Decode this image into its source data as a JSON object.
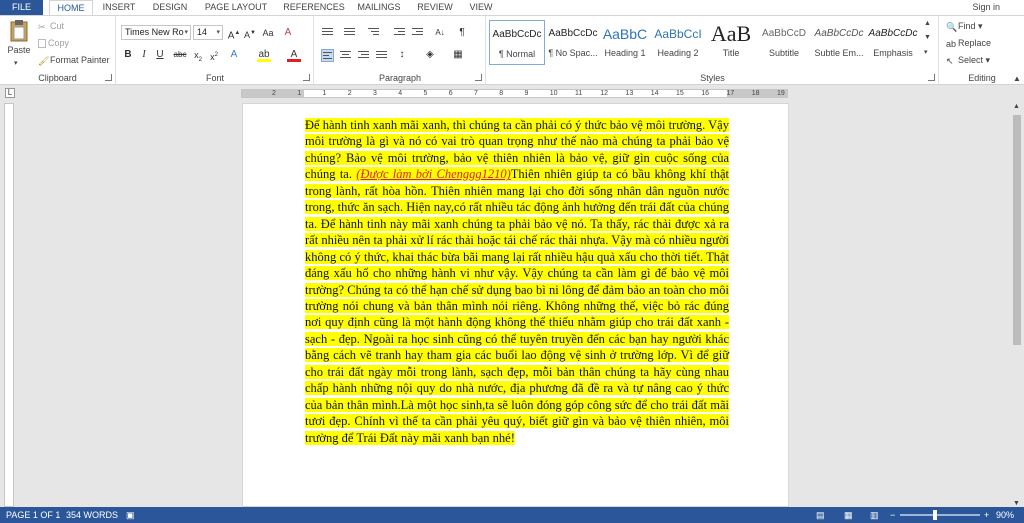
{
  "tabs": {
    "file": "FILE",
    "home": "HOME",
    "insert": "INSERT",
    "design": "DESIGN",
    "page_layout": "PAGE LAYOUT",
    "references": "REFERENCES",
    "mailings": "MAILINGS",
    "review": "REVIEW",
    "view": "VIEW"
  },
  "signin": "Sign in",
  "clipboard": {
    "label": "Clipboard",
    "paste": "Paste",
    "cut": "Cut",
    "copy": "Copy",
    "format_painter": "Format Painter"
  },
  "font": {
    "label": "Font",
    "name": "Times New Ro",
    "size": "14"
  },
  "paragraph": {
    "label": "Paragraph"
  },
  "styles": {
    "label": "Styles",
    "items": [
      {
        "preview": "AaBbCcDc",
        "name": "¶ Normal"
      },
      {
        "preview": "AaBbCcDc",
        "name": "¶ No Spac..."
      },
      {
        "preview": "AaBbC",
        "name": "Heading 1"
      },
      {
        "preview": "AaBbCcI",
        "name": "Heading 2"
      },
      {
        "preview": "AaB",
        "name": "Title"
      },
      {
        "preview": "AaBbCcD",
        "name": "Subtitle"
      },
      {
        "preview": "AaBbCcDc",
        "name": "Subtle Em..."
      },
      {
        "preview": "AaBbCcDc",
        "name": "Emphasis"
      }
    ]
  },
  "editing": {
    "label": "Editing",
    "find": "Find",
    "replace": "Replace",
    "select": "Select"
  },
  "ruler_ticks": [
    "2",
    "1",
    "1",
    "2",
    "3",
    "4",
    "5",
    "6",
    "7",
    "8",
    "9",
    "10",
    "11",
    "12",
    "13",
    "14",
    "15",
    "16",
    "17",
    "18",
    "19"
  ],
  "document": {
    "text1": "Để hành tinh xanh mãi xanh, thì chúng ta cần phải có ý thức bảo vệ môi trường. Vậy môi trường là gì và nó có vai trò quan trọng như thế nào mà chúng ta phải bảo vệ chúng? Bảo vệ môi trường, bảo vệ thiên nhiên là bảo vệ, giữ gìn cuộc sống của chúng ta. ",
    "credit": "(Được làm bởi Chenggg1210)",
    "text2": "Thiên nhiên giúp ta có bầu không khí thật trong lành, rất hòa hồn. Thiên nhiên mang lại cho đời sống nhân dân nguồn nước trong, thức ăn sạch. Hiện nay,có rất nhiều tác động ảnh hưởng đến trái đất của chúng ta. Để hành tinh này mãi xanh chúng ta phải bảo vệ nó. Ta thấy, rác thải được xả ra rất nhiều nên ta phải xử lí rác thải hoặc tái chế rác thải nhựa. Vậy mà có nhiều người không có ý thức, khai thác bừa bãi mang lại rất nhiều hậu quả xấu cho thời tiết. Thật đáng xấu hổ cho những hành vi như vậy. Vậy chúng ta cần làm gì để bảo vệ môi trường? Chúng ta có thể hạn chế sử dụng bao bì ni lông để đảm bảo an toàn cho môi trường nói chung và bản thân mình nói riêng. Không những thế, việc bỏ rác đúng nơi quy định cũng là một hành động không thể thiếu nhằm giúp cho trái đất xanh - sạch - đẹp. Ngoài ra học sinh cũng có thể tuyên truyền đến các bạn hay người khác bằng cách vẽ tranh hay tham gia các buổi lao động vệ sinh ở trường lớp. Vì để giữ cho trái đất ngày mỗi trong lành, sạch đẹp, mỗi bản thân chúng ta hãy cùng nhau chấp hành những nội quy do nhà nước, địa phương đã đề ra và tự nâng cao ý thức của bản thân mình.Là một học sinh,ta sẽ luôn đóng góp công sức để cho trái đất mãi tươi đẹp. Chính vì thế ta cần phải yêu quý, biết giữ gìn và bảo vệ thiên nhiên, môi trường để Trái Đất này mãi xanh bạn nhé!"
  },
  "status": {
    "page": "PAGE 1 OF 1",
    "words": "354 WORDS",
    "zoom": "90%"
  },
  "zoom_level": 0.9,
  "colors": {
    "accent": "#2b579a",
    "highlight": "#ffff00",
    "credit_text": "#e02020"
  }
}
